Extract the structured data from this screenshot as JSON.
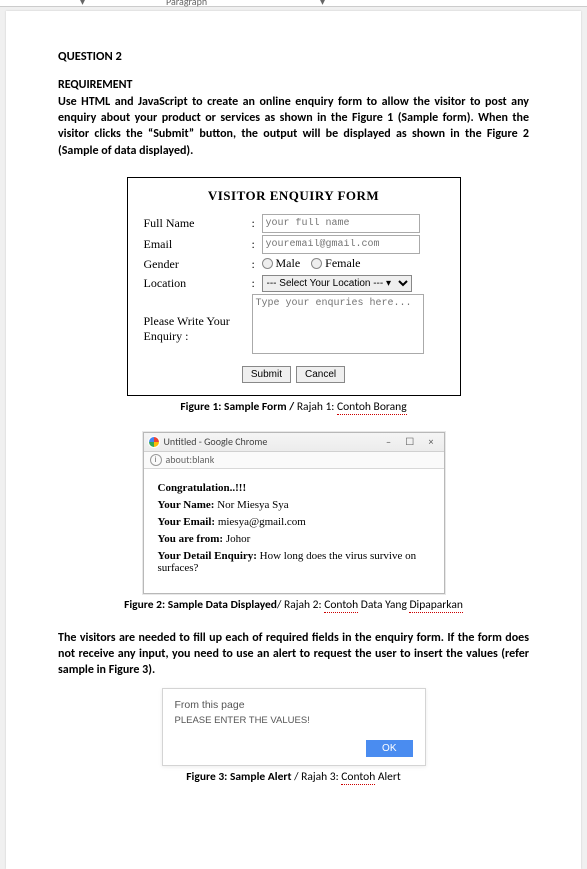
{
  "toolbar": {
    "dd1": "▾",
    "style": "Paragraph",
    "dd2": "▾"
  },
  "q_title": "QUESTION 2",
  "req": {
    "title": "REQUIREMENT",
    "body": "Use HTML and JavaScript to create an online enquiry form to allow the visitor to post any enquiry about your product or services as shown in the Figure 1 (Sample form).  When the visitor clicks the “Submit” button, the output will be displayed as shown in the Figure 2 (Sample of data displayed)."
  },
  "form": {
    "title": "VISITOR ENQUIRY FORM",
    "rows": {
      "fullname": {
        "label": "Full Name",
        "placeholder": "your full name"
      },
      "email": {
        "label": "Email",
        "placeholder": "youremail@gmail.com"
      },
      "gender": {
        "label": "Gender",
        "opt1": "Male",
        "opt2": "Female"
      },
      "location": {
        "label": "Location",
        "selected": "--- Select Your Location --- ▾"
      },
      "enquiry": {
        "label": "Please Write Your Enquiry :",
        "placeholder": "Type your enquries here..."
      }
    },
    "buttons": {
      "submit": "Submit",
      "cancel": "Cancel"
    }
  },
  "caption1": {
    "bold": "Figure 1: Sample Form / ",
    "plain": "Rajah 1: ",
    "spell": "Contoh Borang"
  },
  "chrome": {
    "title": "Untitled - Google Chrome",
    "winbtns": "–  ☐  ×",
    "addr": "about:blank",
    "body": {
      "line1": "Congratulation..!!!",
      "name_k": "Your Name: ",
      "name_v": "Nor Miesya Sya",
      "email_k": "Your Email: ",
      "email_v": "miesya@gmail.com",
      "from_k": "You are from: ",
      "from_v": "Johor",
      "enq_k": "Your Detail Enquiry: ",
      "enq_v": "How long does the virus survive on surfaces?"
    }
  },
  "caption2": {
    "bold": "Figure 2: Sample Data Displayed",
    "plain": "/ Rajah 2: ",
    "spell1": "Contoh",
    "plain2": " Data Yang ",
    "spell2": "Dipaparkan"
  },
  "para2": "The visitors are needed to fill up each of required fields in the enquiry form. If the form does not receive any input, you need to use an alert to request the user to insert the values (refer sample in Figure 3).",
  "alert": {
    "title": "From this page",
    "msg": "PLEASE ENTER THE VALUES!",
    "ok": "OK"
  },
  "caption3": {
    "bold": "Figure 3: Sample Alert ",
    "plain": "/ Rajah 3: ",
    "spell1": "Contoh",
    "plain2": " Alert"
  }
}
